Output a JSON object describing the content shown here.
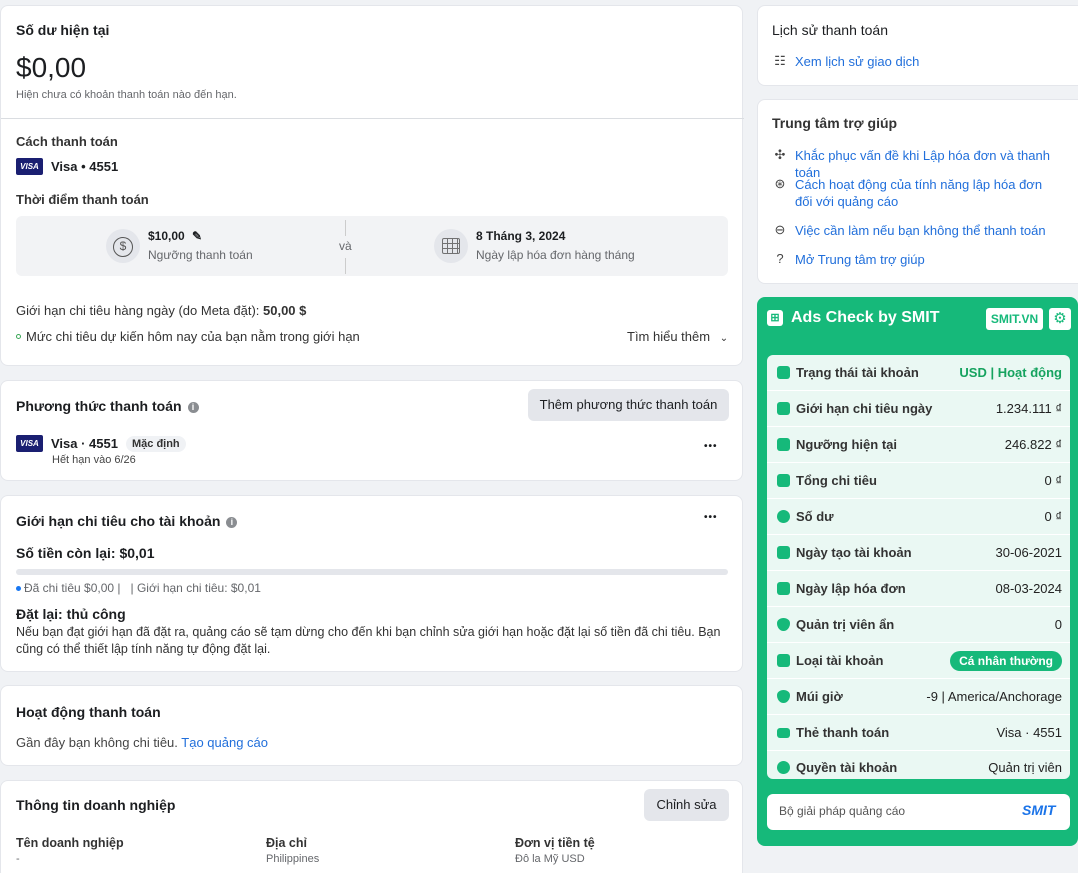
{
  "balance": {
    "title": "Số dư hiện tại",
    "amount": "$0,00",
    "note": "Hiện chưa có khoản thanh toán nào đến hạn.",
    "method_label": "Cách thanh toán",
    "card_brand": "VISA",
    "card_text": "Visa • 4551",
    "timing_label": "Thời điểm thanh toán",
    "threshold_value": "$10,00",
    "threshold_caption": "Ngưỡng thanh toán",
    "and_text": "và",
    "bill_date": "8 Tháng 3, 2024",
    "bill_caption": "Ngày lập hóa đơn hàng tháng",
    "daily_limit_text": "Giới hạn chi tiêu hàng ngày (do Meta đặt): ",
    "daily_limit_value": "50,00 $",
    "status_text": "Mức chi tiêu dự kiến hôm nay của bạn nằm trong giới hạn",
    "learn_more": "Tìm hiểu thêm"
  },
  "payment_methods": {
    "title": "Phương thức thanh toán",
    "add_button": "Thêm phương thức thanh toán",
    "card_brand": "VISA",
    "card_text": "Visa · 4551",
    "default_badge": "Mặc định",
    "expiry": "Hết hạn vào 6/26",
    "more": "•••"
  },
  "account_limit": {
    "title": "Giới hạn chi tiêu cho tài khoản",
    "remaining": "Số tiền còn lại: $0,01",
    "spent": "Đã chi tiêu $0,00 |",
    "limit": "| Giới hạn chi tiêu: $0,01",
    "reset_title": "Đặt lại: thủ công",
    "reset_desc": "Nếu bạn đạt giới hạn đã đặt ra, quảng cáo sẽ tạm dừng cho đến khi bạn chỉnh sửa giới hạn hoặc đặt lại số tiền đã chi tiêu. Bạn cũng có thể thiết lập tính năng tự động đặt lại.",
    "more": "•••",
    "progress_fraction": 0
  },
  "activity": {
    "title": "Hoạt động thanh toán",
    "text": "Gần đây bạn không chi tiêu.",
    "link": "Tạo quảng cáo"
  },
  "business": {
    "title": "Thông tin doanh nghiệp",
    "edit_button": "Chỉnh sửa",
    "name_label": "Tên doanh nghiệp",
    "name_value": "-",
    "address_label": "Địa chỉ",
    "address_value": "Philippines",
    "currency_label": "Đơn vị tiền tệ",
    "currency_value": "Đô la Mỹ USD"
  },
  "history": {
    "title": "Lịch sử thanh toán",
    "link": "Xem lịch sử giao dịch"
  },
  "help": {
    "title": "Trung tâm trợ giúp",
    "items": [
      "Khắc phục vấn đề khi Lập hóa đơn và thanh toán",
      "Cách hoạt động của tính năng lập hóa đơn đối với quảng cáo",
      "Việc cần làm nếu bạn không thể thanh toán",
      "Mở Trung tâm trợ giúp"
    ]
  },
  "smit": {
    "title": "Ads Check by SMIT",
    "badge": "SMIT.VN",
    "rows": [
      {
        "label": "Trạng thái tài khoản",
        "value": "USD | Hoạt động"
      },
      {
        "label": "Giới hạn chi tiêu ngày",
        "value": "1.234.111 ₫"
      },
      {
        "label": "Ngưỡng hiện tại",
        "value": "246.822 ₫"
      },
      {
        "label": "Tổng chi tiêu",
        "value": "0 ₫"
      },
      {
        "label": "Số dư",
        "value": "0 ₫"
      },
      {
        "label": "Ngày tạo tài khoản",
        "value": "30-06-2021"
      },
      {
        "label": "Ngày lập hóa đơn",
        "value": "08-03-2024"
      },
      {
        "label": "Quản trị viên ẩn",
        "value": "0"
      },
      {
        "label": "Loại tài khoản",
        "value": "Cá nhân thường"
      },
      {
        "label": "Múi giờ",
        "value": "-9 | America/Anchorage"
      },
      {
        "label": "Thẻ thanh toán",
        "value": "Visa · 4551"
      },
      {
        "label": "Quyền tài khoản",
        "value": "Quản trị viên"
      }
    ],
    "footer_text": "Bộ giải pháp quảng cáo",
    "footer_logo": "SMIT",
    "accent": "#16b97a"
  }
}
